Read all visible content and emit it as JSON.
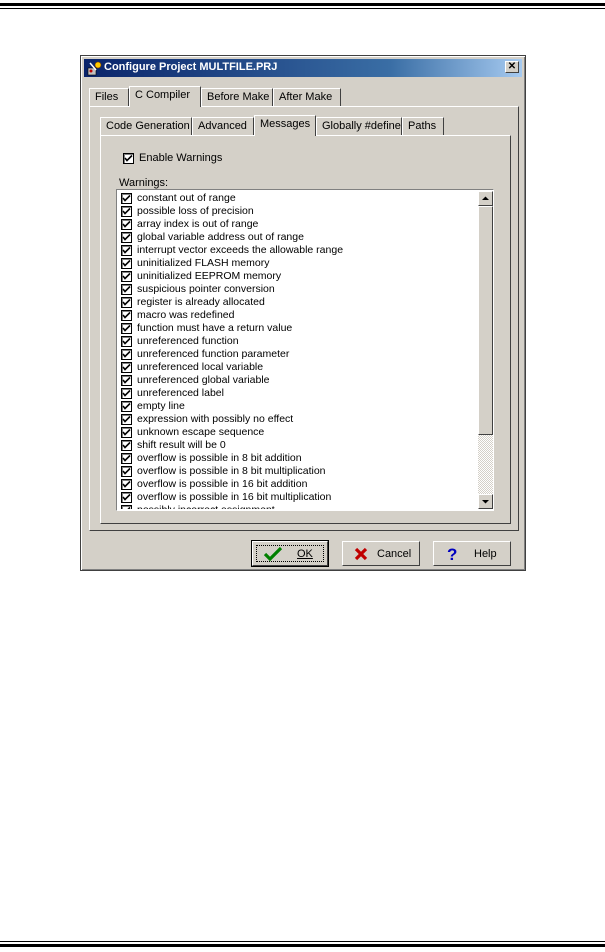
{
  "dialog": {
    "title": "Configure Project MULTFILE.PRJ",
    "close_label": "x"
  },
  "main_tabs": [
    {
      "label": "Files",
      "active": false
    },
    {
      "label": "C Compiler",
      "active": true
    },
    {
      "label": "Before Make",
      "active": false
    },
    {
      "label": "After Make",
      "active": false
    }
  ],
  "sub_tabs": [
    {
      "label": "Code Generation",
      "active": false
    },
    {
      "label": "Advanced",
      "active": false
    },
    {
      "label": "Messages",
      "active": true
    },
    {
      "label": "Globally #define",
      "active": false
    },
    {
      "label": "Paths",
      "active": false
    }
  ],
  "enable_warnings": {
    "label": "Enable Warnings",
    "checked": true
  },
  "warnings_label": "Warnings:",
  "warnings": [
    "constant out of range",
    "possible loss of precision",
    "array index is out of range",
    "global variable address out of range",
    "interrupt vector exceeds the allowable range",
    "uninitialized FLASH memory",
    "uninitialized EEPROM memory",
    "suspicious pointer conversion",
    "register is already allocated",
    "macro was redefined",
    "function must have a return value",
    "unreferenced function",
    "unreferenced function parameter",
    "unreferenced local variable",
    "unreferenced global variable",
    "unreferenced label",
    "empty line",
    "expression with possibly no effect",
    "unknown escape sequence",
    "shift result will be 0",
    "overflow is possible in 8 bit addition",
    "overflow is possible in 8 bit multiplication",
    "overflow is possible in 16 bit addition",
    "overflow is possible in 16 bit multiplication",
    "possibly incorrect assignment"
  ],
  "buttons": {
    "ok": "OK",
    "cancel": "Cancel",
    "help": "Help"
  },
  "colors": {
    "title_gradient_start": "#0a246a",
    "title_gradient_end": "#a6caf0",
    "dialog_face": "#d4d0c8",
    "ok_check": "#008000",
    "cancel_x": "#c00000",
    "help_mark": "#0000c0"
  }
}
